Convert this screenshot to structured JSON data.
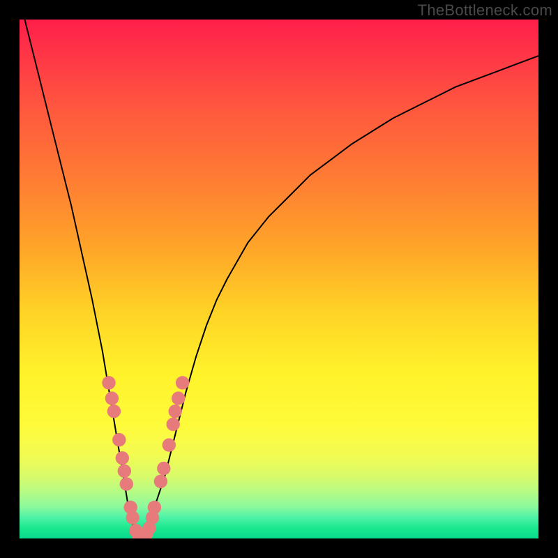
{
  "watermark": "TheBottleneck.com",
  "chart_data": {
    "type": "line",
    "title": "",
    "xlabel": "",
    "ylabel": "",
    "xlim": [
      0,
      100
    ],
    "ylim": [
      0,
      100
    ],
    "grid": false,
    "legend": false,
    "series": [
      {
        "name": "curve",
        "color": "#000000",
        "x": [
          0,
          2,
          4,
          6,
          8,
          10,
          12,
          14,
          16,
          18,
          20,
          21,
          22,
          23,
          24,
          25,
          26,
          28,
          30,
          32,
          34,
          36,
          38,
          40,
          44,
          48,
          52,
          56,
          60,
          64,
          68,
          72,
          76,
          80,
          84,
          88,
          92,
          96,
          100
        ],
        "y": [
          104,
          96,
          88,
          80,
          72,
          64,
          55,
          46,
          36,
          24,
          12,
          6,
          2,
          0,
          0,
          2,
          6,
          12,
          20,
          28,
          35,
          41,
          46,
          50,
          57,
          62,
          66,
          70,
          73,
          76,
          78.5,
          81,
          83,
          85,
          87,
          88.5,
          90,
          91.5,
          93
        ]
      }
    ],
    "highlight_clusters": {
      "name": "points",
      "color": "#e77b7b",
      "radius_pct": 1.3,
      "points": [
        {
          "x": 17.2,
          "y": 30.0
        },
        {
          "x": 17.8,
          "y": 27.0
        },
        {
          "x": 18.2,
          "y": 24.5
        },
        {
          "x": 19.2,
          "y": 19.0
        },
        {
          "x": 19.8,
          "y": 15.5
        },
        {
          "x": 20.2,
          "y": 13.0
        },
        {
          "x": 20.6,
          "y": 10.5
        },
        {
          "x": 21.4,
          "y": 6.0
        },
        {
          "x": 21.8,
          "y": 4.0
        },
        {
          "x": 22.4,
          "y": 1.5
        },
        {
          "x": 23.0,
          "y": 0.2
        },
        {
          "x": 23.8,
          "y": 0.2
        },
        {
          "x": 24.4,
          "y": 0.8
        },
        {
          "x": 25.0,
          "y": 2.0
        },
        {
          "x": 25.6,
          "y": 4.0
        },
        {
          "x": 26.0,
          "y": 6.0
        },
        {
          "x": 27.2,
          "y": 11.0
        },
        {
          "x": 27.8,
          "y": 13.5
        },
        {
          "x": 28.8,
          "y": 18.0
        },
        {
          "x": 29.6,
          "y": 22.0
        },
        {
          "x": 30.0,
          "y": 24.5
        },
        {
          "x": 30.6,
          "y": 27.0
        },
        {
          "x": 31.4,
          "y": 30.0
        }
      ]
    },
    "gradient_background": {
      "direction": "vertical",
      "stops": [
        {
          "pos": 0.0,
          "color": "#ff1e4a"
        },
        {
          "pos": 0.3,
          "color": "#ff7a34"
        },
        {
          "pos": 0.68,
          "color": "#fff22a"
        },
        {
          "pos": 1.0,
          "color": "#07d98d"
        }
      ]
    }
  }
}
